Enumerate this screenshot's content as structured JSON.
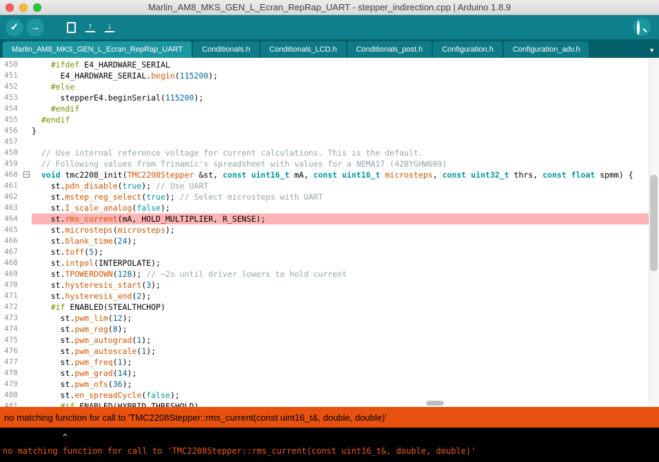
{
  "window": {
    "title": "Marlin_AM8_MKS_GEN_L_Ecran_RepRap_UART - stepper_indirection.cpp | Arduino 1.8.9"
  },
  "toolbar": {
    "buttons": [
      {
        "id": "verify",
        "label": "Verify",
        "icon": "check-icon"
      },
      {
        "id": "upload",
        "label": "Upload",
        "icon": "arrow-right-icon"
      },
      {
        "id": "new",
        "label": "New",
        "icon": "page-icon"
      },
      {
        "id": "open",
        "label": "Open",
        "icon": "up-arrow-tray-icon"
      },
      {
        "id": "save",
        "label": "Save",
        "icon": "down-arrow-tray-icon"
      },
      {
        "id": "serial-monitor",
        "label": "Serial Monitor",
        "icon": "magnifier-icon"
      }
    ],
    "glyphs": {
      "verify": "✓",
      "upload": "→",
      "open_arrow": "↑",
      "save_arrow": "↓"
    }
  },
  "tabs": [
    {
      "label": "Marlin_AM8_MKS_GEN_L_Ecran_RepRap_UART",
      "active": true
    },
    {
      "label": "Conditionals.h",
      "active": false
    },
    {
      "label": "Conditionals_LCD.h",
      "active": false
    },
    {
      "label": "Conditionals_post.h",
      "active": false
    },
    {
      "label": "Configuration.h",
      "active": false
    },
    {
      "label": "Configuration_adv.h",
      "active": false
    }
  ],
  "tab_menu_glyph": "▼",
  "editor": {
    "lines": [
      {
        "num": "450",
        "seg": [
          [
            "p",
            "    "
          ],
          [
            "d",
            "#ifdef"
          ],
          [
            "p",
            " E4_HARDWARE_SERIAL"
          ]
        ]
      },
      {
        "num": "451",
        "seg": [
          [
            "p",
            "      E4_HARDWARE_SERIAL."
          ],
          [
            "f",
            "begin"
          ],
          [
            "p",
            "("
          ],
          [
            "n",
            "115200"
          ],
          [
            "p",
            ");"
          ]
        ]
      },
      {
        "num": "452",
        "seg": [
          [
            "p",
            "    "
          ],
          [
            "d",
            "#else"
          ]
        ]
      },
      {
        "num": "453",
        "seg": [
          [
            "p",
            "      stepperE4.beginSerial("
          ],
          [
            "n",
            "115200"
          ],
          [
            "p",
            ");"
          ]
        ]
      },
      {
        "num": "454",
        "seg": [
          [
            "p",
            "    "
          ],
          [
            "d",
            "#endif"
          ]
        ]
      },
      {
        "num": "455",
        "seg": [
          [
            "p",
            "  "
          ],
          [
            "d",
            "#endif"
          ]
        ]
      },
      {
        "num": "456",
        "seg": [
          [
            "p",
            "}"
          ]
        ]
      },
      {
        "num": "457",
        "seg": []
      },
      {
        "num": "458",
        "seg": [
          [
            "p",
            "  "
          ],
          [
            "c",
            "// Use internal reference voltage for current calculations. This is the default."
          ]
        ]
      },
      {
        "num": "459",
        "seg": [
          [
            "p",
            "  "
          ],
          [
            "c",
            "// Following values from Trinamic's spreadsheet with values for a NEMA17 (42BYGHW609)"
          ]
        ]
      },
      {
        "num": "460",
        "fold": true,
        "seg": [
          [
            "p",
            "  "
          ],
          [
            "k",
            "void"
          ],
          [
            "p",
            " tmc2208_init("
          ],
          [
            "f",
            "TMC2208Stepper"
          ],
          [
            "p",
            " &st, "
          ],
          [
            "k",
            "const"
          ],
          [
            "p",
            " "
          ],
          [
            "k",
            "uint16_t"
          ],
          [
            "p",
            " mA, "
          ],
          [
            "k",
            "const"
          ],
          [
            "p",
            " "
          ],
          [
            "k",
            "uint16_t"
          ],
          [
            "p",
            " "
          ],
          [
            "f",
            "microsteps"
          ],
          [
            "p",
            ", "
          ],
          [
            "k",
            "const"
          ],
          [
            "p",
            " "
          ],
          [
            "k",
            "uint32_t"
          ],
          [
            "p",
            " thrs, "
          ],
          [
            "k",
            "const"
          ],
          [
            "p",
            " "
          ],
          [
            "k",
            "float"
          ],
          [
            "p",
            " spmm) {"
          ]
        ]
      },
      {
        "num": "461",
        "seg": [
          [
            "p",
            "    st."
          ],
          [
            "f",
            "pdn_disable"
          ],
          [
            "p",
            "("
          ],
          [
            "l",
            "true"
          ],
          [
            "p",
            "); "
          ],
          [
            "c",
            "// Use UART"
          ]
        ]
      },
      {
        "num": "462",
        "seg": [
          [
            "p",
            "    st."
          ],
          [
            "f",
            "mstep_reg_select"
          ],
          [
            "p",
            "("
          ],
          [
            "l",
            "true"
          ],
          [
            "p",
            "); "
          ],
          [
            "c",
            "// Select microsteps with UART"
          ]
        ]
      },
      {
        "num": "463",
        "seg": [
          [
            "p",
            "    st."
          ],
          [
            "f",
            "I_scale_analog"
          ],
          [
            "p",
            "("
          ],
          [
            "l",
            "false"
          ],
          [
            "p",
            ");"
          ]
        ]
      },
      {
        "num": "464",
        "error": true,
        "seg": [
          [
            "p",
            "    st."
          ],
          [
            "f",
            "rms_current"
          ],
          [
            "p",
            "(mA, HOLD_MULTIPLIER, R_SENSE);"
          ]
        ]
      },
      {
        "num": "465",
        "seg": [
          [
            "p",
            "    st."
          ],
          [
            "f",
            "microsteps"
          ],
          [
            "p",
            "("
          ],
          [
            "f",
            "microsteps"
          ],
          [
            "p",
            ");"
          ]
        ]
      },
      {
        "num": "466",
        "seg": [
          [
            "p",
            "    st."
          ],
          [
            "f",
            "blank_time"
          ],
          [
            "p",
            "("
          ],
          [
            "n",
            "24"
          ],
          [
            "p",
            ");"
          ]
        ]
      },
      {
        "num": "467",
        "seg": [
          [
            "p",
            "    st."
          ],
          [
            "f",
            "toff"
          ],
          [
            "p",
            "("
          ],
          [
            "n",
            "5"
          ],
          [
            "p",
            ");"
          ]
        ]
      },
      {
        "num": "468",
        "seg": [
          [
            "p",
            "    st."
          ],
          [
            "f",
            "intpol"
          ],
          [
            "p",
            "(INTERPOLATE);"
          ]
        ]
      },
      {
        "num": "469",
        "seg": [
          [
            "p",
            "    st."
          ],
          [
            "f",
            "TPOWERDOWN"
          ],
          [
            "p",
            "("
          ],
          [
            "n",
            "128"
          ],
          [
            "p",
            "); "
          ],
          [
            "c",
            "// ~2s until driver lowers to hold current"
          ]
        ]
      },
      {
        "num": "470",
        "seg": [
          [
            "p",
            "    st."
          ],
          [
            "f",
            "hysteresis_start"
          ],
          [
            "p",
            "("
          ],
          [
            "n",
            "3"
          ],
          [
            "p",
            ");"
          ]
        ]
      },
      {
        "num": "471",
        "seg": [
          [
            "p",
            "    st."
          ],
          [
            "f",
            "hysteresis_end"
          ],
          [
            "p",
            "("
          ],
          [
            "n",
            "2"
          ],
          [
            "p",
            ");"
          ]
        ]
      },
      {
        "num": "472",
        "seg": [
          [
            "p",
            "    "
          ],
          [
            "d",
            "#if"
          ],
          [
            "p",
            " ENABLED(STEALTHCHOP)"
          ]
        ]
      },
      {
        "num": "473",
        "seg": [
          [
            "p",
            "      st."
          ],
          [
            "f",
            "pwm_lim"
          ],
          [
            "p",
            "("
          ],
          [
            "n",
            "12"
          ],
          [
            "p",
            ");"
          ]
        ]
      },
      {
        "num": "474",
        "seg": [
          [
            "p",
            "      st."
          ],
          [
            "f",
            "pwm_reg"
          ],
          [
            "p",
            "("
          ],
          [
            "n",
            "8"
          ],
          [
            "p",
            ");"
          ]
        ]
      },
      {
        "num": "475",
        "seg": [
          [
            "p",
            "      st."
          ],
          [
            "f",
            "pwm_autograd"
          ],
          [
            "p",
            "("
          ],
          [
            "n",
            "1"
          ],
          [
            "p",
            ");"
          ]
        ]
      },
      {
        "num": "476",
        "seg": [
          [
            "p",
            "      st."
          ],
          [
            "f",
            "pwm_autoscale"
          ],
          [
            "p",
            "("
          ],
          [
            "n",
            "1"
          ],
          [
            "p",
            ");"
          ]
        ]
      },
      {
        "num": "477",
        "seg": [
          [
            "p",
            "      st."
          ],
          [
            "f",
            "pwm_freq"
          ],
          [
            "p",
            "("
          ],
          [
            "n",
            "1"
          ],
          [
            "p",
            ");"
          ]
        ]
      },
      {
        "num": "478",
        "seg": [
          [
            "p",
            "      st."
          ],
          [
            "f",
            "pwm_grad"
          ],
          [
            "p",
            "("
          ],
          [
            "n",
            "14"
          ],
          [
            "p",
            ");"
          ]
        ]
      },
      {
        "num": "479",
        "seg": [
          [
            "p",
            "      st."
          ],
          [
            "f",
            "pwm_ofs"
          ],
          [
            "p",
            "("
          ],
          [
            "n",
            "36"
          ],
          [
            "p",
            ");"
          ]
        ]
      },
      {
        "num": "480",
        "seg": [
          [
            "p",
            "      st."
          ],
          [
            "f",
            "en_spreadCycle"
          ],
          [
            "p",
            "("
          ],
          [
            "l",
            "false"
          ],
          [
            "p",
            ");"
          ]
        ]
      },
      {
        "num": "481",
        "seg": [
          [
            "p",
            "      "
          ],
          [
            "d",
            "#if"
          ],
          [
            "p",
            " ENABLED(HYBRID_THRESHOLD)"
          ]
        ]
      }
    ]
  },
  "status_bar": {
    "message": "no matching function for call to 'TMC2208Stepper::rms_current(const uint16_t&, double, double)'"
  },
  "console": {
    "lines": [
      {
        "style": "plain",
        "text": "            ^"
      },
      {
        "style": "error",
        "text": "no matching function for call to 'TMC2208Stepper::rms_current(const uint16_t&, double, double)'"
      }
    ]
  },
  "colors": {
    "toolbar_teal": "#0e7f8b",
    "tabbar_teal": "#03606b",
    "active_tab_teal": "#1c96a1",
    "error_status_orange": "#e8520e",
    "error_line_pink": "#ffb5b5",
    "keyword_teal": "#00979c",
    "function_orange": "#d35400",
    "directive_olive": "#728e00",
    "literal_blue": "#006699",
    "comment_gray": "#95a5a6"
  }
}
